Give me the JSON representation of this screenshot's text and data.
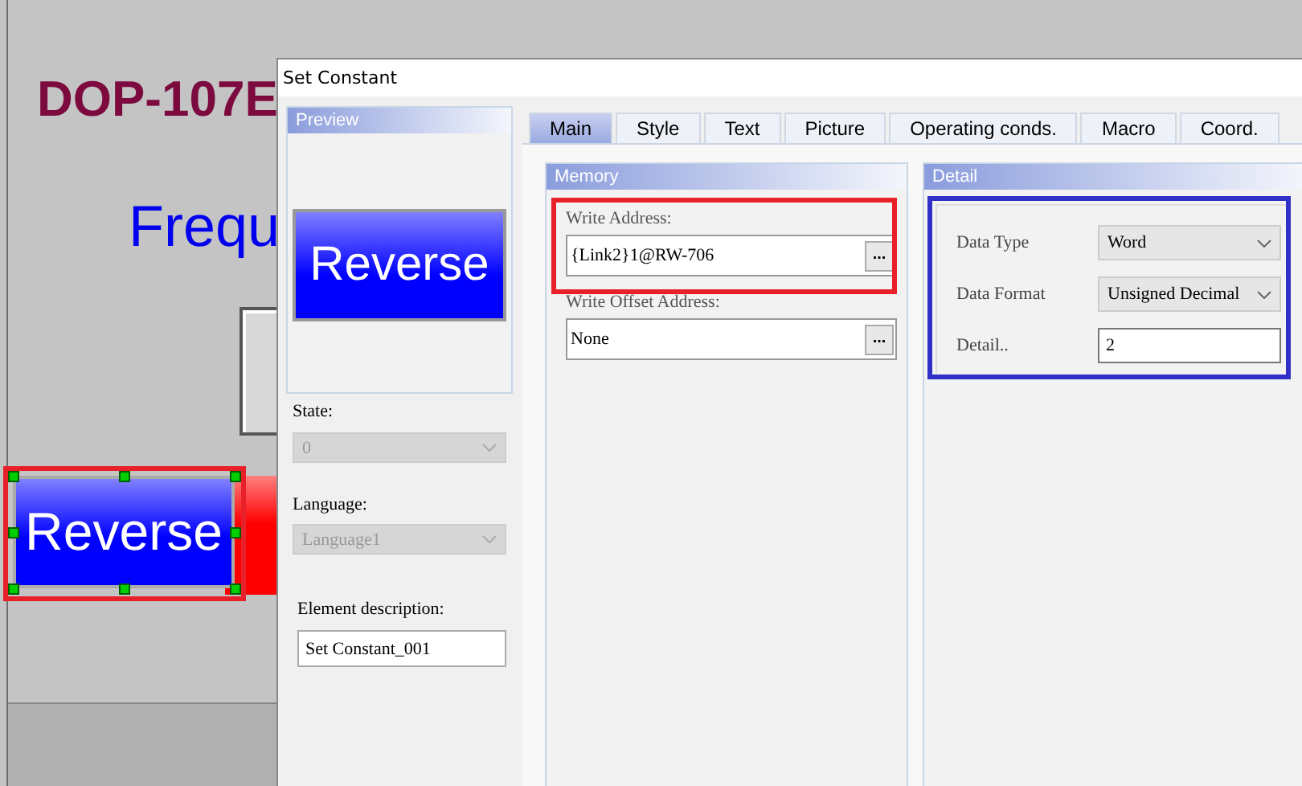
{
  "canvas": {
    "title": "DOP-107E",
    "label": "Frequ",
    "button": {
      "label": "Reverse",
      "selected": true
    }
  },
  "dialog": {
    "title": "Set Constant",
    "preview": {
      "header": "Preview",
      "button_label": "Reverse"
    },
    "state": {
      "label": "State:",
      "value": "0",
      "disabled": true
    },
    "language": {
      "label": "Language:",
      "value": "Language1",
      "disabled": true
    },
    "element_description": {
      "label": "Element description:",
      "value": "Set Constant_001"
    },
    "tabs": [
      {
        "label": "Main",
        "selected": true
      },
      {
        "label": "Style",
        "selected": false
      },
      {
        "label": "Text",
        "selected": false
      },
      {
        "label": "Picture",
        "selected": false
      },
      {
        "label": "Operating conds.",
        "selected": false
      },
      {
        "label": "Macro",
        "selected": false
      },
      {
        "label": "Coord.",
        "selected": false
      }
    ],
    "memory": {
      "header": "Memory",
      "write_address": {
        "label": "Write Address:",
        "value": "{Link2}1@RW-706",
        "browse": "..."
      },
      "write_offset_address": {
        "label": "Write Offset Address:",
        "value": "None",
        "browse": "..."
      }
    },
    "detail": {
      "header": "Detail",
      "fields": [
        {
          "kind": "select",
          "label": "Data Type",
          "value": "Word"
        },
        {
          "kind": "select",
          "label": "Data Format",
          "value": "Unsigned Decimal"
        },
        {
          "kind": "input",
          "label": "Detail..",
          "value": "2"
        }
      ]
    }
  }
}
